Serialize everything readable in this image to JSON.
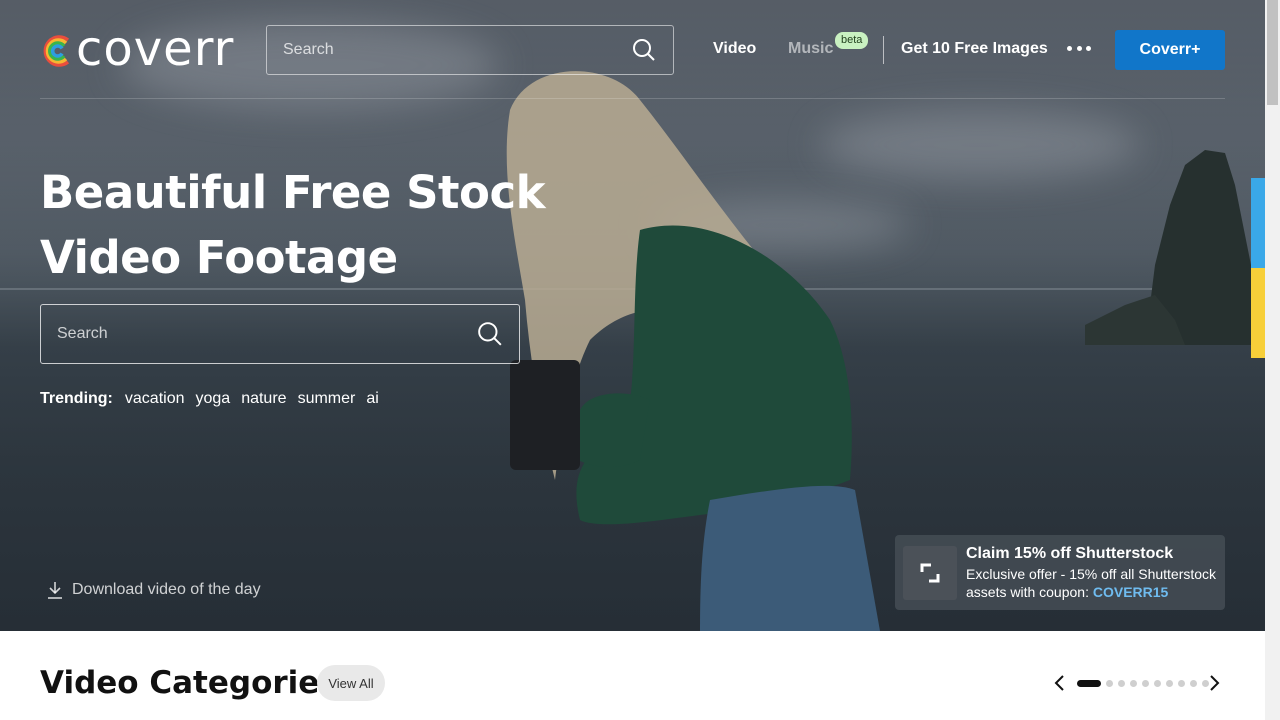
{
  "header": {
    "logo_text": "coverr",
    "search_placeholder": "Search",
    "nav": {
      "video": "Video",
      "music": "Music",
      "music_badge": "beta",
      "free_images": "Get 10 Free Images"
    },
    "cta_label": "Coverr+"
  },
  "hero": {
    "title_line1": "Beautiful Free Stock",
    "title_line2": "Video Footage",
    "search_placeholder": "Search",
    "trending_label": "Trending:",
    "trending": [
      "vacation",
      "yoga",
      "nature",
      "summer",
      "ai"
    ],
    "download_label": "Download video of the day"
  },
  "promo": {
    "title": "Claim 15% off Shutterstock",
    "line1": "Exclusive offer - 15% off all Shutterstock",
    "line2": "assets with coupon:",
    "coupon": "COVERR15"
  },
  "categories": {
    "title": "Video Categories",
    "view_all": "View All",
    "page_count": 10,
    "active_page": 1
  },
  "colors": {
    "accent": "#1176c9",
    "beta_badge": "#c9f1c1",
    "coupon": "#6fbcf0"
  },
  "icons": [
    "search-icon",
    "more-icon",
    "download-icon",
    "shutterstock-icon",
    "chevron-left-icon",
    "chevron-right-icon"
  ]
}
